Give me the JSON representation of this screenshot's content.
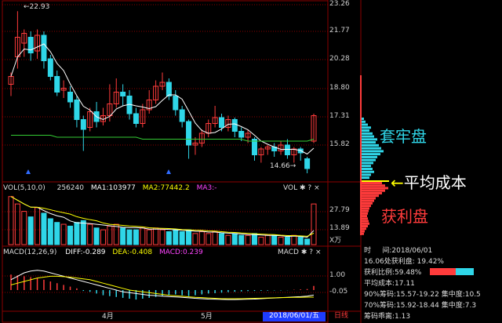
{
  "header": {
    "vol_title": "VOL(5,10,0)",
    "vol_value": "256240",
    "ma1": "MA1:103977",
    "ma2": "MA2:77442.2",
    "ma3": "MA3:-",
    "macd_title": "MACD(12,26,9)",
    "diff": "DIFF:-0.289",
    "dea": "DEA:-0.408",
    "macd": "MACD:0.239",
    "vol_tag": "VOL",
    "macd_tag": "MACD"
  },
  "colors": {
    "up": "#ff3b3b",
    "down": "#2fd6e8",
    "ma5": "#ffffff",
    "ma_green": "#33cc33",
    "ma1": "#ffffff",
    "ma2": "#ffff00",
    "ma3": "#ff44ff",
    "grid": "#8b0000",
    "chips_profit": "#ff3b3b",
    "chips_trapped": "#2fd6e8",
    "cost_line": "#ffff00"
  },
  "annotations": {
    "high_label": "22.93",
    "low_label": "14.66"
  },
  "price_axis": [
    "23.26",
    "21.77",
    "20.28",
    "18.80",
    "17.31",
    "15.82"
  ],
  "vol_axis": [
    "27.79",
    "13.89"
  ],
  "vol_unit": "X万",
  "macd_axis": [
    "1.00",
    "-0.05"
  ],
  "x_axis": {
    "month_labels": [
      "4月",
      "5月"
    ],
    "date_box": "2018/06/01/五",
    "mode_box": "日线"
  },
  "chips": {
    "trapped_label": "套牢盘",
    "cost_label": "平均成本",
    "profit_label": "获利盘",
    "profile_trapped": [
      3,
      5,
      8,
      12,
      10,
      14,
      16,
      20,
      18,
      22,
      25,
      28,
      24,
      20,
      18,
      15,
      12,
      14,
      16,
      12,
      10
    ],
    "profile_profit": [
      26,
      30,
      34,
      30,
      26,
      22,
      18,
      16,
      14,
      12,
      10,
      9,
      8,
      7,
      8,
      9,
      10,
      8,
      6,
      4,
      3
    ],
    "profit_ratio": 0.5948
  },
  "info": {
    "time_label": "时",
    "time_label2": "间:2018/06/01",
    "profit_at": "16.06处获利盘: 19.42%",
    "profit_ratio_text": "获利比例:59.48%",
    "avg_cost": "平均成本:17.11",
    "r90": "90%筹码:15.57-19.22",
    "c90": "集中度:10.5",
    "r70": "70%筹码:15.92-18.44",
    "c70": "集中度:7.3",
    "distance": "筹码乖离:1.13"
  },
  "chart_data": {
    "type": "candlestick",
    "ylim": [
      14.3,
      23.26
    ],
    "candles": [
      {
        "o": 19.2,
        "c": 19.6,
        "h": 19.8,
        "l": 18.6
      },
      {
        "o": 20.6,
        "c": 21.6,
        "h": 22.93,
        "l": 20.0
      },
      {
        "o": 21.3,
        "c": 21.8,
        "h": 22.0,
        "l": 20.6
      },
      {
        "o": 21.6,
        "c": 20.8,
        "h": 21.9,
        "l": 20.4
      },
      {
        "o": 20.9,
        "c": 21.7,
        "h": 22.0,
        "l": 20.5
      },
      {
        "o": 21.7,
        "c": 20.4,
        "h": 21.9,
        "l": 20.0
      },
      {
        "o": 20.5,
        "c": 19.6,
        "h": 20.7,
        "l": 19.4
      },
      {
        "o": 19.6,
        "c": 18.8,
        "h": 19.9,
        "l": 18.6
      },
      {
        "o": 18.9,
        "c": 19.0,
        "h": 19.4,
        "l": 18.5
      },
      {
        "o": 18.8,
        "c": 18.3,
        "h": 19.1,
        "l": 18.0
      },
      {
        "o": 18.4,
        "c": 17.4,
        "h": 18.6,
        "l": 17.0
      },
      {
        "o": 17.4,
        "c": 16.9,
        "h": 17.6,
        "l": 15.8
      },
      {
        "o": 17.0,
        "c": 17.8,
        "h": 18.0,
        "l": 16.8
      },
      {
        "o": 17.8,
        "c": 17.3,
        "h": 18.3,
        "l": 17.0
      },
      {
        "o": 17.3,
        "c": 17.6,
        "h": 18.0,
        "l": 17.1
      },
      {
        "o": 17.6,
        "c": 18.2,
        "h": 19.2,
        "l": 17.3
      },
      {
        "o": 18.2,
        "c": 18.8,
        "h": 19.5,
        "l": 18.0
      },
      {
        "o": 18.8,
        "c": 18.6,
        "h": 19.2,
        "l": 18.1
      },
      {
        "o": 18.6,
        "c": 17.7,
        "h": 18.9,
        "l": 17.4
      },
      {
        "o": 17.7,
        "c": 17.2,
        "h": 18.0,
        "l": 17.0
      },
      {
        "o": 17.2,
        "c": 17.9,
        "h": 18.2,
        "l": 17.0
      },
      {
        "o": 17.9,
        "c": 18.4,
        "h": 18.9,
        "l": 17.7
      },
      {
        "o": 18.4,
        "c": 19.1,
        "h": 19.4,
        "l": 18.2
      },
      {
        "o": 19.1,
        "c": 19.3,
        "h": 19.8,
        "l": 18.9
      },
      {
        "o": 19.3,
        "c": 18.6,
        "h": 19.5,
        "l": 18.4
      },
      {
        "o": 18.6,
        "c": 17.9,
        "h": 18.9,
        "l": 17.6
      },
      {
        "o": 17.9,
        "c": 17.3,
        "h": 18.1,
        "l": 17.0
      },
      {
        "o": 17.3,
        "c": 16.1,
        "h": 17.4,
        "l": 15.4
      },
      {
        "o": 16.1,
        "c": 16.2,
        "h": 16.5,
        "l": 15.6
      },
      {
        "o": 16.2,
        "c": 16.7,
        "h": 16.9,
        "l": 16.0
      },
      {
        "o": 16.7,
        "c": 17.2,
        "h": 17.4,
        "l": 16.5
      },
      {
        "o": 17.2,
        "c": 17.5,
        "h": 18.1,
        "l": 17.0
      },
      {
        "o": 17.5,
        "c": 17.0,
        "h": 17.7,
        "l": 16.8
      },
      {
        "o": 17.0,
        "c": 17.4,
        "h": 17.6,
        "l": 16.8
      },
      {
        "o": 17.4,
        "c": 16.8,
        "h": 17.5,
        "l": 16.5
      },
      {
        "o": 16.8,
        "c": 16.5,
        "h": 17.0,
        "l": 16.3
      },
      {
        "o": 16.5,
        "c": 16.7,
        "h": 16.9,
        "l": 16.2
      },
      {
        "o": 16.4,
        "c": 15.6,
        "h": 16.5,
        "l": 15.3
      },
      {
        "o": 15.6,
        "c": 15.9,
        "h": 16.0,
        "l": 15.2
      },
      {
        "o": 15.9,
        "c": 16.0,
        "h": 16.1,
        "l": 15.6
      },
      {
        "o": 16.0,
        "c": 15.8,
        "h": 16.2,
        "l": 15.5
      },
      {
        "o": 15.8,
        "c": 16.1,
        "h": 16.3,
        "l": 15.6
      },
      {
        "o": 16.1,
        "c": 15.6,
        "h": 16.4,
        "l": 15.4
      },
      {
        "o": 15.6,
        "c": 15.9,
        "h": 16.0,
        "l": 15.2
      },
      {
        "o": 15.9,
        "c": 15.7,
        "h": 16.0,
        "l": 15.3
      },
      {
        "o": 15.4,
        "c": 14.9,
        "h": 15.5,
        "l": 14.66
      },
      {
        "o": 16.3,
        "c": 17.6,
        "h": 17.7,
        "l": 16.2
      }
    ],
    "ma_green": [
      16.6,
      16.6,
      16.6,
      16.6,
      16.6,
      16.6,
      16.6,
      16.5,
      16.5,
      16.5,
      16.5,
      16.5,
      16.5,
      16.5,
      16.5,
      16.5,
      16.5,
      16.5,
      16.5,
      16.5,
      16.4,
      16.4,
      16.4,
      16.4,
      16.4,
      16.4,
      16.4,
      16.4,
      16.4,
      16.4,
      16.4,
      16.4,
      16.4,
      16.4,
      16.4,
      16.4,
      16.3,
      16.3,
      16.3,
      16.3,
      16.3,
      16.3,
      16.3,
      16.3,
      16.3,
      16.3,
      16.4
    ],
    "volume": [
      26,
      22,
      18,
      15,
      20,
      17,
      14,
      12,
      11,
      10,
      12,
      13,
      11,
      9,
      8,
      10,
      11,
      9,
      8,
      8,
      9,
      8,
      9,
      8,
      7,
      8,
      7,
      8,
      6,
      7,
      6,
      7,
      6,
      5,
      6,
      5,
      5,
      6,
      4,
      5,
      5,
      4,
      4,
      5,
      4,
      3,
      22
    ],
    "macd_hist": [
      0.9,
      0.85,
      0.8,
      0.75,
      0.7,
      0.6,
      0.5,
      0.4,
      0.3,
      0.2,
      0.1,
      -0.05,
      -0.1,
      -0.2,
      -0.3,
      -0.35,
      -0.4,
      -0.45,
      -0.5,
      -0.55,
      -0.5,
      -0.45,
      -0.4,
      -0.35,
      -0.3,
      -0.25,
      -0.3,
      -0.35,
      -0.3,
      -0.25,
      -0.2,
      -0.18,
      -0.15,
      -0.12,
      -0.1,
      -0.08,
      -0.06,
      -0.05,
      -0.04,
      -0.03,
      -0.02,
      -0.02,
      -0.01,
      0.02,
      0.04,
      0.06,
      0.24
    ],
    "macd_dif": [
      0.6,
      0.8,
      1.0,
      1.1,
      1.15,
      1.1,
      1.0,
      0.9,
      0.8,
      0.7,
      0.6,
      0.5,
      0.4,
      0.3,
      0.2,
      0.1,
      0.0,
      -0.1,
      -0.15,
      -0.2,
      -0.25,
      -0.3,
      -0.32,
      -0.35,
      -0.38,
      -0.4,
      -0.42,
      -0.45,
      -0.48,
      -0.5,
      -0.52,
      -0.53,
      -0.54,
      -0.55,
      -0.55,
      -0.54,
      -0.53,
      -0.52,
      -0.5,
      -0.48,
      -0.46,
      -0.44,
      -0.42,
      -0.4,
      -0.38,
      -0.35,
      -0.29
    ],
    "macd_dea": [
      0.3,
      0.4,
      0.5,
      0.6,
      0.7,
      0.75,
      0.8,
      0.8,
      0.78,
      0.75,
      0.7,
      0.65,
      0.6,
      0.5,
      0.4,
      0.3,
      0.2,
      0.1,
      0.0,
      -0.05,
      -0.1,
      -0.15,
      -0.2,
      -0.25,
      -0.3,
      -0.33,
      -0.36,
      -0.39,
      -0.42,
      -0.44,
      -0.46,
      -0.48,
      -0.5,
      -0.5,
      -0.5,
      -0.5,
      -0.49,
      -0.48,
      -0.47,
      -0.46,
      -0.45,
      -0.44,
      -0.43,
      -0.42,
      -0.42,
      -0.41,
      -0.408
    ]
  }
}
